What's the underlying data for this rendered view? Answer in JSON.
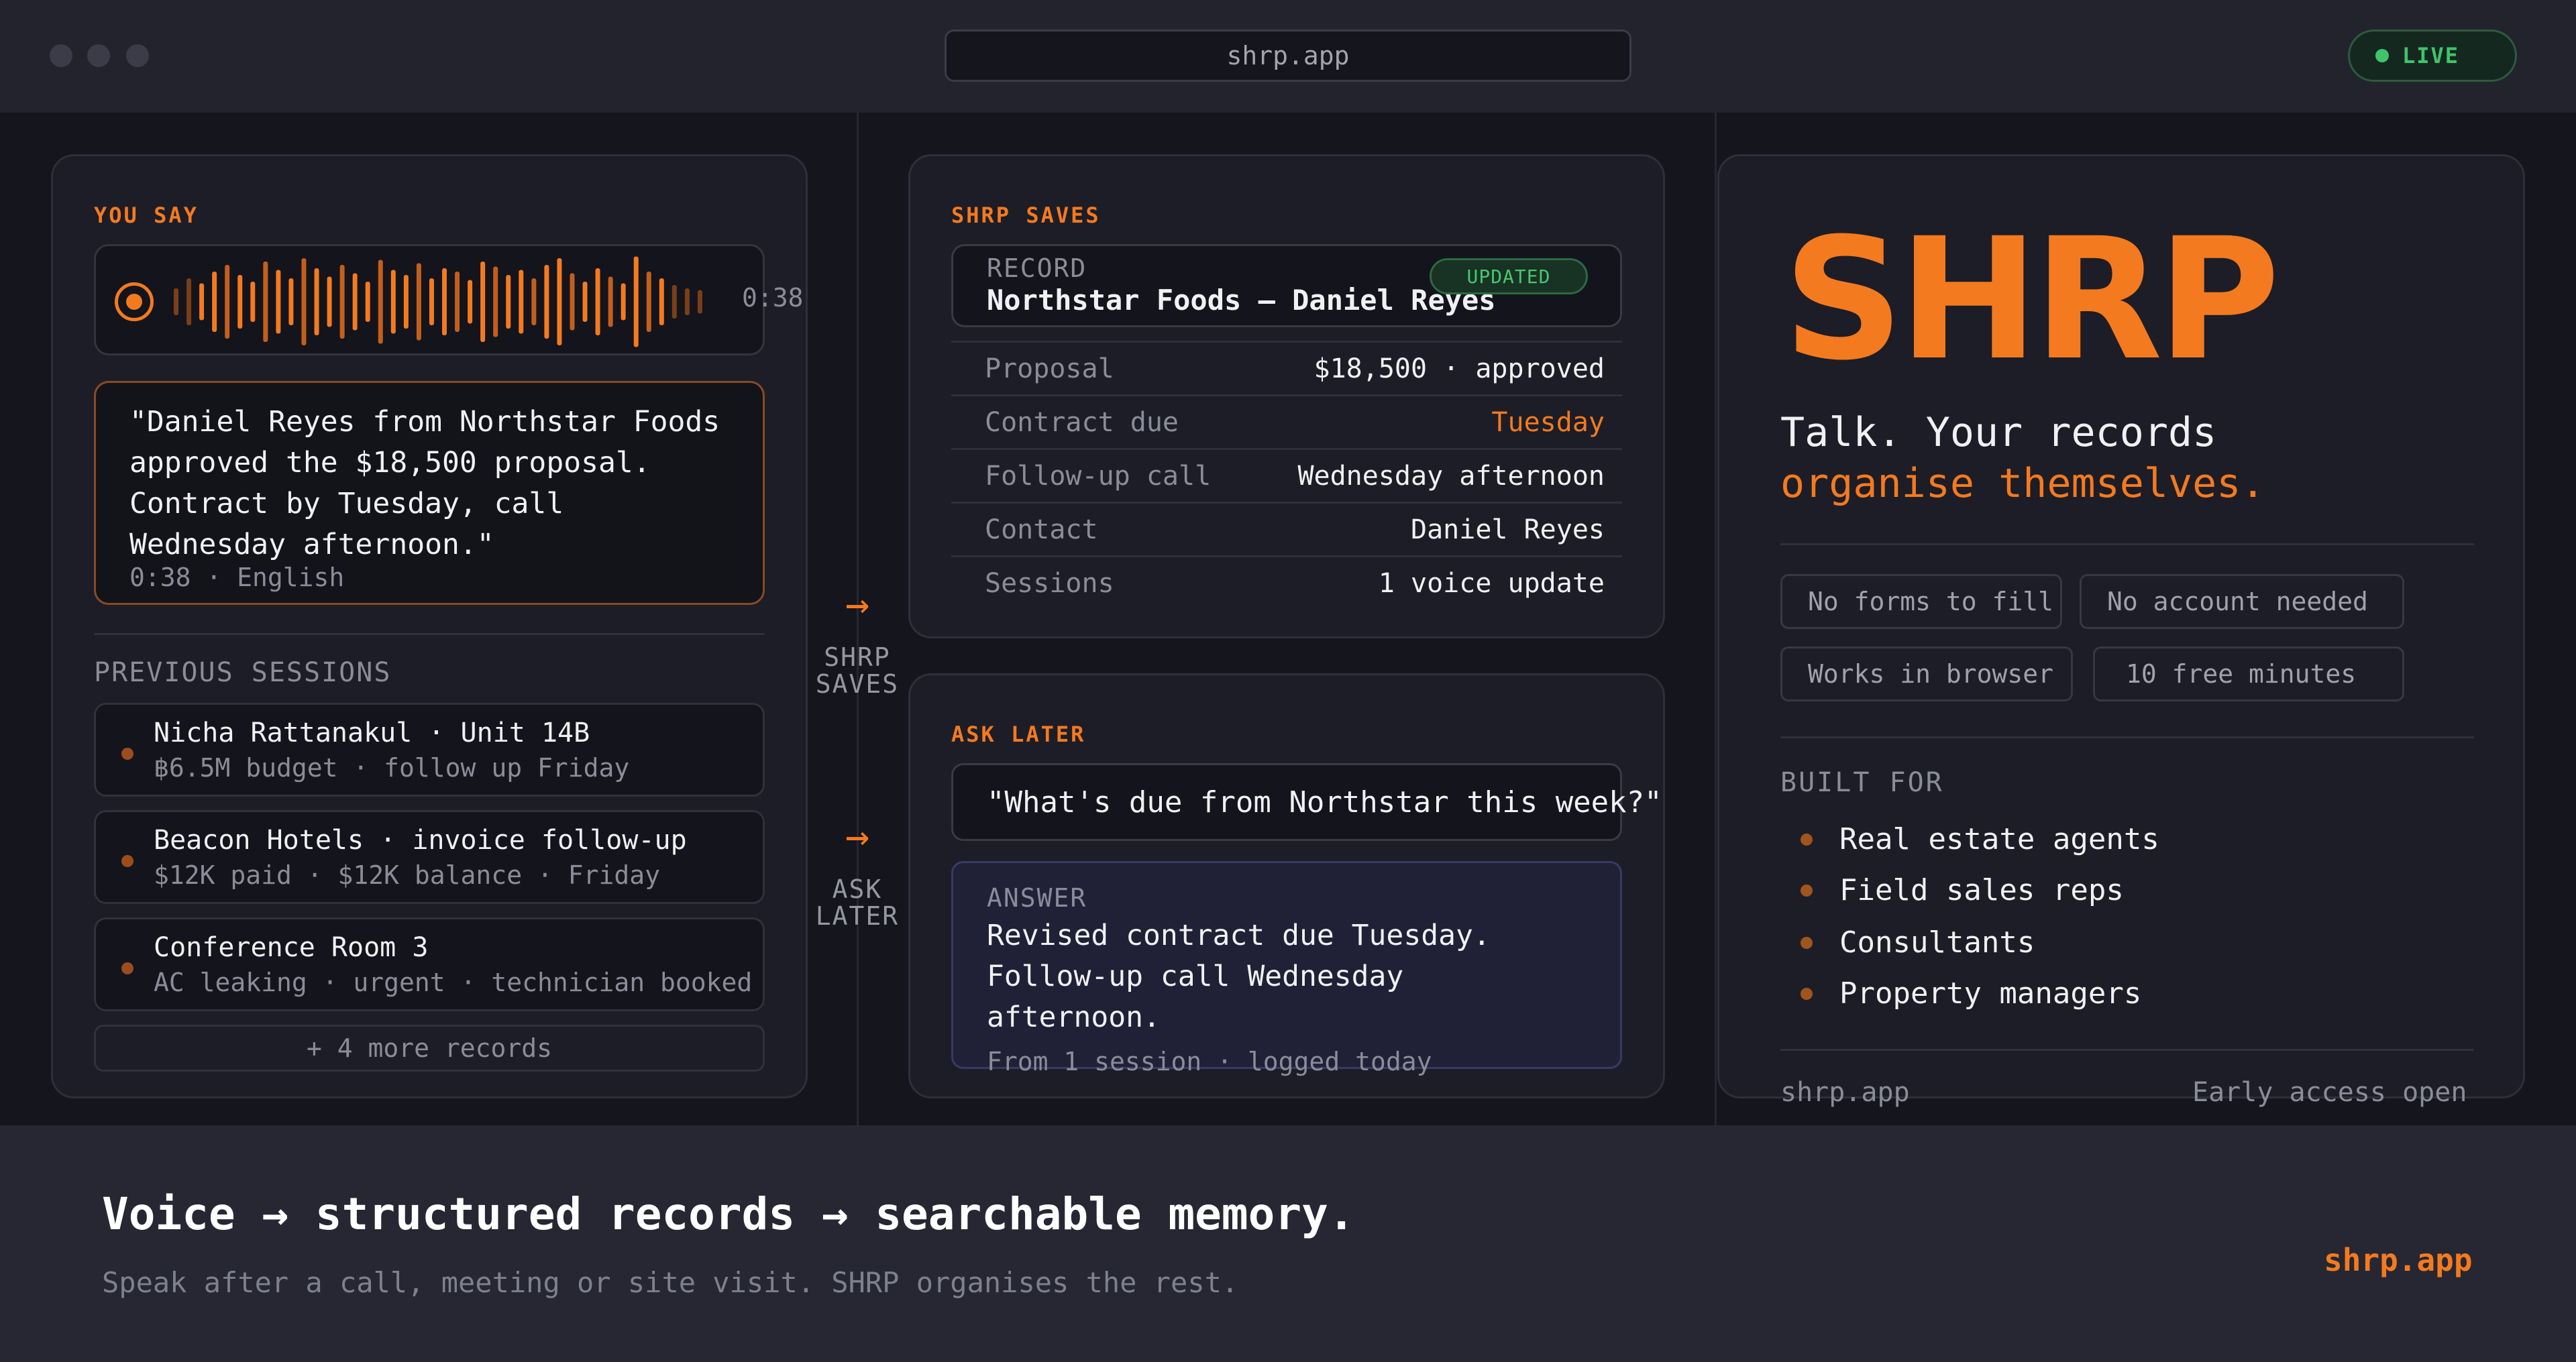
{
  "window": {
    "url": "shrp.app",
    "status": "LIVE"
  },
  "you_say": {
    "label": "YOU SAY",
    "duration": "0:38",
    "transcript": "\"Daniel Reyes from Northstar Foods approved the $18,500 proposal. Contract by Tuesday, call Wednesday afternoon.\"",
    "meta": "0:38 · English",
    "previous_label": "PREVIOUS SESSIONS",
    "sessions": [
      {
        "title": "Nicha Rattanakul · Unit 14B",
        "detail": "฿6.5M budget · follow up Friday"
      },
      {
        "title": "Beacon Hotels · invoice follow-up",
        "detail": "$12K paid · $12K balance · Friday"
      },
      {
        "title": "Conference Room 3",
        "detail": "AC leaking · urgent · technician booked"
      }
    ],
    "more": "+ 4 more records"
  },
  "flow": {
    "saves_line1": "SHRP",
    "saves_line2": "SAVES",
    "ask_line1": "ASK",
    "ask_line2": "LATER"
  },
  "saves": {
    "label": "SHRP SAVES",
    "record_label": "RECORD",
    "record_title": "Northstar Foods — Daniel Reyes",
    "badge": "UPDATED",
    "accent": "#f47a1f",
    "rows": [
      {
        "key": "Proposal",
        "value": "$18,500 · approved"
      },
      {
        "key": "Contract due",
        "value": "Tuesday"
      },
      {
        "key": "Follow-up call",
        "value": "Wednesday afternoon"
      },
      {
        "key": "Contact",
        "value": "Daniel Reyes"
      },
      {
        "key": "Sessions",
        "value": "1 voice update"
      }
    ]
  },
  "ask": {
    "label": "ASK LATER",
    "question": "\"What's due from Northstar this week?\"",
    "answer_label": "ANSWER",
    "answer_line1": "Revised contract due Tuesday.",
    "answer_line2": "Follow-up call Wednesday afternoon.",
    "answer_meta": "From 1 session · logged today"
  },
  "brand": {
    "name": "SHRP",
    "tagline1": "Talk. Your records",
    "tagline2": "organise themselves.",
    "chips": [
      "No forms to fill",
      "No account needed",
      "Works in browser",
      "10 free minutes"
    ],
    "built_for_label": "BUILT FOR",
    "built_for": [
      "Real estate agents",
      "Field sales reps",
      "Consultants",
      "Property managers"
    ],
    "footer_left": "shrp.app",
    "footer_right": "Early access open"
  },
  "footer": {
    "headline": "Voice → structured records → searchable memory.",
    "sub": "Speak after a call, meeting or site visit. SHRP organises the rest.",
    "link": "shrp.app"
  }
}
